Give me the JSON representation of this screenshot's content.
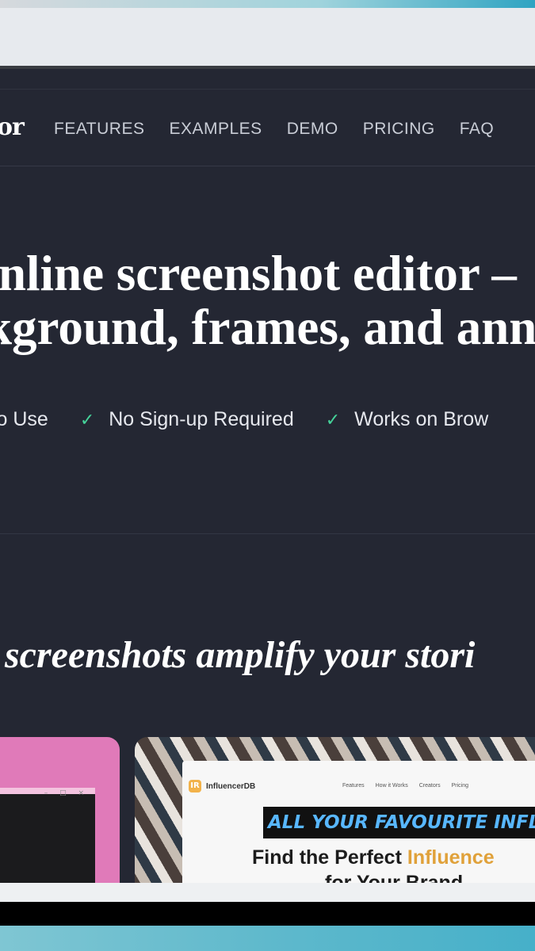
{
  "nav": {
    "brand": "or",
    "links": [
      "FEATURES",
      "EXAMPLES",
      "DEMO",
      "PRICING",
      "FAQ"
    ]
  },
  "hero": {
    "title_line1": "nline screenshot editor –",
    "title_line2": "kground, frames, and ann"
  },
  "features": [
    {
      "label": "y To Use",
      "icon": "check-icon"
    },
    {
      "label": "No Sign-up Required",
      "icon": "check-icon"
    },
    {
      "label": "Works on Brow",
      "icon": "check-icon"
    }
  ],
  "tagline": "screenshots amplify your stori",
  "showcase": {
    "window_controls": "– □ ×",
    "shot_logo": "IR",
    "shot_brand": "InfluencerDB",
    "shot_links": [
      "Features",
      "How it Works",
      "Creators",
      "Pricing"
    ],
    "banner": "ALL YOUR FAVOURITE INFLUENCERS",
    "headline_part1": "Find the Perfect ",
    "headline_highlight": "Influence",
    "headline_line2": "for Your Brand",
    "badge_icon": "star-icon"
  },
  "colors": {
    "page_bg": "#242733",
    "accent_check": "#45d39a",
    "card_pink": "#e07ab9",
    "banner_text": "#58b7ff",
    "highlight": "#e0a13a"
  }
}
